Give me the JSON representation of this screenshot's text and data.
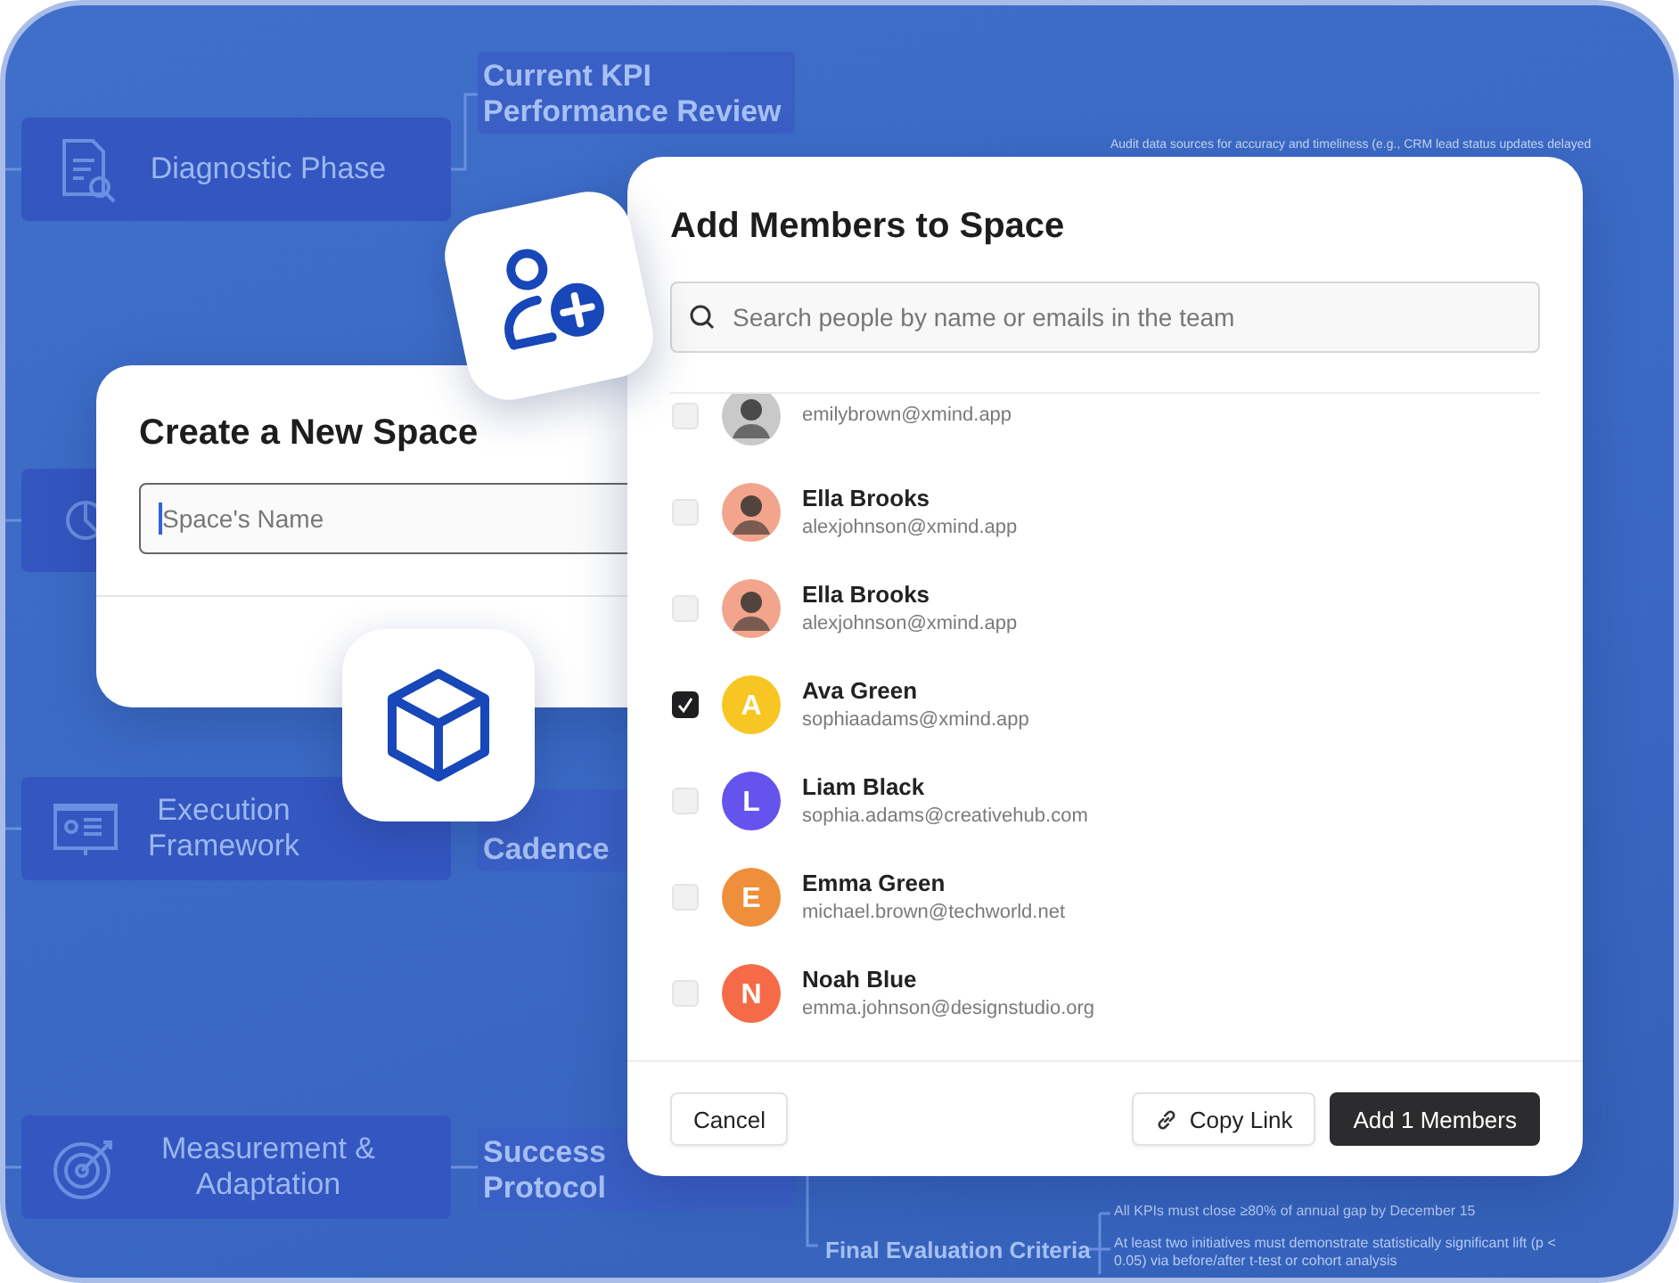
{
  "mind_map": {
    "branches": [
      {
        "kind": "document",
        "label": "Diagnostic Phase"
      },
      {
        "kind": "chart"
      },
      {
        "kind": "presentation",
        "label": "Execution Framework"
      },
      {
        "kind": "target",
        "label": "Measurement & Adaptation"
      }
    ],
    "topics": [
      {
        "lines": [
          "Current KPI",
          "Performance Review"
        ]
      },
      {
        "lines": [
          "Cadence"
        ]
      },
      {
        "lines": [
          "Success",
          "Protocol"
        ]
      }
    ],
    "final_topic": "Final Evaluation Criteria",
    "notes": [
      "Audit data sources for accuracy and timeliness (e.g., CRM lead status updates delayed",
      "All KPIs must close ≥80% of annual gap by December 15",
      "At least two initiatives must demonstrate statistically significant lift (p < 0.05) via before/after t-test or cohort analysis"
    ]
  },
  "create_space": {
    "title": "Create a New Space",
    "name_field": {
      "placeholder": "Space's Name"
    }
  },
  "add_members": {
    "title": "Add Members to Space",
    "search": {
      "placeholder": "Search people by name or emails in the team"
    },
    "members": [
      {
        "email": "emilybrown@xmind.app",
        "checked": false
      },
      {
        "name": "Ella Brooks",
        "email": "alexjohnson@xmind.app",
        "checked": false
      },
      {
        "name": "Ella Brooks",
        "email": "alexjohnson@xmind.app",
        "checked": false
      },
      {
        "name": "Ava Green",
        "email": "sophiaadams@xmind.app",
        "checked": true,
        "avatar": {
          "kind": "initial",
          "initial": "A",
          "color": "#f8c623"
        }
      },
      {
        "name": "Liam Black",
        "email": "sophia.adams@creativehub.com",
        "checked": false,
        "avatar": {
          "kind": "initial",
          "initial": "L",
          "color": "#6553ee"
        }
      },
      {
        "name": "Emma Green",
        "email": "michael.brown@techworld.net",
        "checked": false,
        "avatar": {
          "kind": "initial",
          "initial": "E",
          "color": "#ef8f3c"
        }
      },
      {
        "name": "Noah Blue",
        "email": "emma.johnson@designstudio.org",
        "checked": false,
        "avatar": {
          "kind": "initial",
          "initial": "N",
          "color": "#f56a47"
        }
      }
    ],
    "buttons": {
      "cancel": "Cancel",
      "copy_link": "Copy Link",
      "add": "Add 1 Members"
    }
  }
}
